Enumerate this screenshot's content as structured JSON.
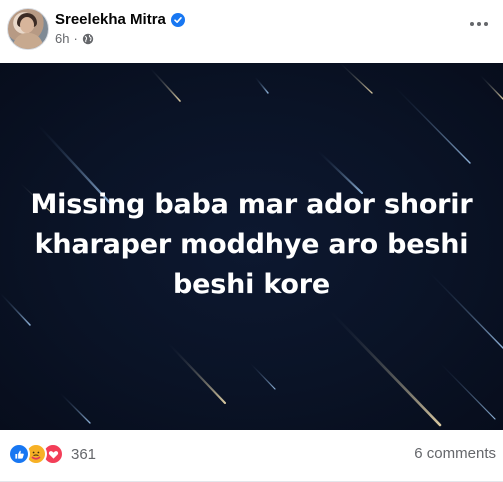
{
  "post": {
    "author": "Sreelekha Mitra",
    "time": "6h",
    "separator": "·",
    "author_verified": true,
    "audience_icon": "globe-icon",
    "more_icon": "more-options-icon",
    "image_text": "Missing baba mar ador shorir\nkharaper moddhye aro beshi\nbeshi kore",
    "image_background": "#0a1326"
  },
  "engagement": {
    "reactions": [
      "like-icon",
      "care-icon",
      "love-icon"
    ],
    "reaction_count": "361",
    "comments_label": "6 comments"
  },
  "colors": {
    "brand_blue": "#1877f2",
    "secondary_text": "#65676b"
  }
}
